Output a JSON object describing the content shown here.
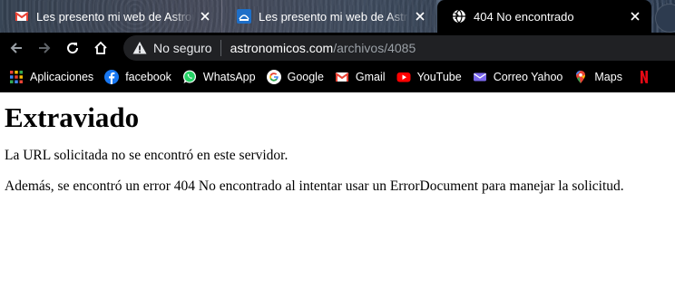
{
  "tabs": [
    {
      "title": "Les presento mi web de Astronomía",
      "favicon": "gmail-icon",
      "active": false
    },
    {
      "title": "Les presento mi web de Astronomía",
      "favicon": "site-icon",
      "active": false
    },
    {
      "title": "404 No encontrado",
      "favicon": "globe-icon",
      "active": true
    }
  ],
  "toolbar": {
    "security_label": "No seguro",
    "url_host": "astronomicos.com",
    "url_path": "/archivos/4085"
  },
  "bookmarks": [
    {
      "label": "Aplicaciones",
      "icon": "apps-grid-icon"
    },
    {
      "label": "facebook",
      "icon": "facebook-icon"
    },
    {
      "label": "WhatsApp",
      "icon": "whatsapp-icon"
    },
    {
      "label": "Google",
      "icon": "google-icon"
    },
    {
      "label": "Gmail",
      "icon": "gmail-icon"
    },
    {
      "label": "YouTube",
      "icon": "youtube-icon"
    },
    {
      "label": "Correo Yahoo",
      "icon": "yahoo-mail-icon"
    },
    {
      "label": "Maps",
      "icon": "maps-icon"
    },
    {
      "label": "",
      "icon": "netflix-icon"
    }
  ],
  "page": {
    "heading": "Extraviado",
    "paragraph1": "La URL solicitada no se encontró en este servidor.",
    "paragraph2": "Además, se encontró un error 404 No encontrado al intentar usar un ErrorDocument para manejar la solicitud."
  },
  "colors": {
    "chrome_bg": "#000000",
    "omnibox_bg": "#202124",
    "url_path": "#9aa0a6",
    "gmail_red": "#EA4335",
    "facebook_blue": "#1877F2",
    "whatsapp_green": "#25D366",
    "youtube_red": "#FF0000",
    "yahoo_purple": "#7B68EE",
    "netflix_red": "#E50914"
  }
}
